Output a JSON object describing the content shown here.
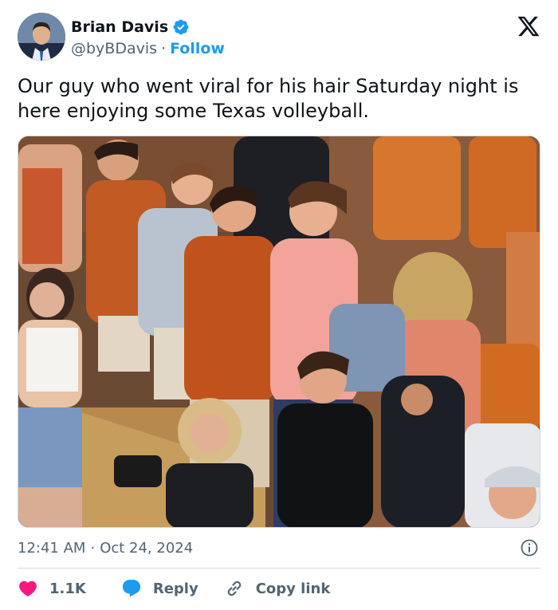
{
  "author": {
    "display_name": "Brian Davis",
    "handle": "@byBDavis",
    "separator": "·",
    "follow_label": "Follow",
    "verified": true
  },
  "tweet": {
    "text": "Our guy who went viral for his hair Saturday night is here enjoying some Texas volleyball."
  },
  "meta": {
    "time": "12:41 AM",
    "separator": "·",
    "date": "Oct 24, 2024"
  },
  "actions": {
    "likes_count": "1.1K",
    "reply_label": "Reply",
    "copy_link_label": "Copy link"
  },
  "colors": {
    "accent": "#1d9bf0",
    "like": "#f91880",
    "text_primary": "#0f1419",
    "text_secondary": "#536471",
    "texas_orange": "#bf5700"
  },
  "icons": {
    "verified": "verified-badge-icon",
    "brand": "x-logo-icon",
    "info": "info-icon",
    "like": "heart-icon",
    "reply": "speech-bubble-icon",
    "copy_link": "link-icon"
  }
}
